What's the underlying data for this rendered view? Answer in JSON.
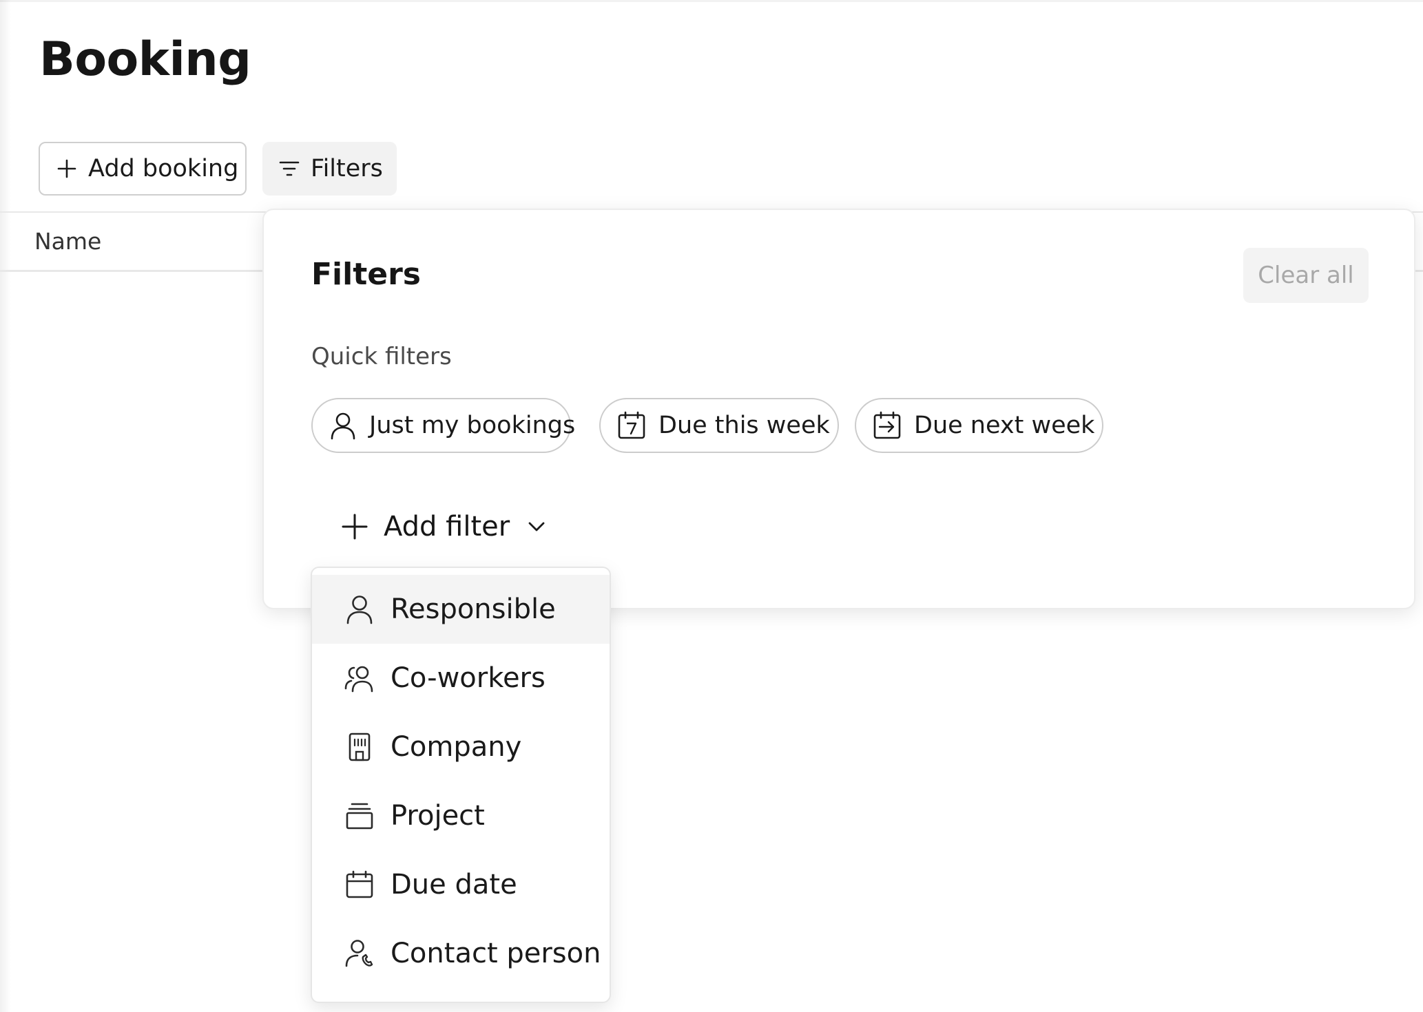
{
  "page": {
    "title": "Booking"
  },
  "toolbar": {
    "add_booking_label": "Add booking",
    "filters_label": "Filters"
  },
  "table": {
    "columns": [
      "Name"
    ]
  },
  "filters_panel": {
    "title": "Filters",
    "clear_all_label": "Clear all",
    "quick_filters_label": "Quick filters",
    "quick_filters": [
      {
        "label": "Just my bookings",
        "icon": "user-icon"
      },
      {
        "label": "Due this week",
        "icon": "calendar-7-icon"
      },
      {
        "label": "Due next week",
        "icon": "calendar-arrow-icon"
      }
    ],
    "add_filter_label": "Add filter"
  },
  "add_filter_menu": {
    "items": [
      {
        "label": "Responsible",
        "icon": "user-icon",
        "highlighted": true
      },
      {
        "label": "Co-workers",
        "icon": "users-icon"
      },
      {
        "label": "Company",
        "icon": "building-icon"
      },
      {
        "label": "Project",
        "icon": "project-stack-icon"
      },
      {
        "label": "Due date",
        "icon": "calendar-icon"
      },
      {
        "label": "Contact person",
        "icon": "contact-person-icon"
      }
    ]
  },
  "colors": {
    "text": "#1a1a1a",
    "muted": "#a8a8a8",
    "border": "#cccccc",
    "hover": "#f4f4f4"
  }
}
